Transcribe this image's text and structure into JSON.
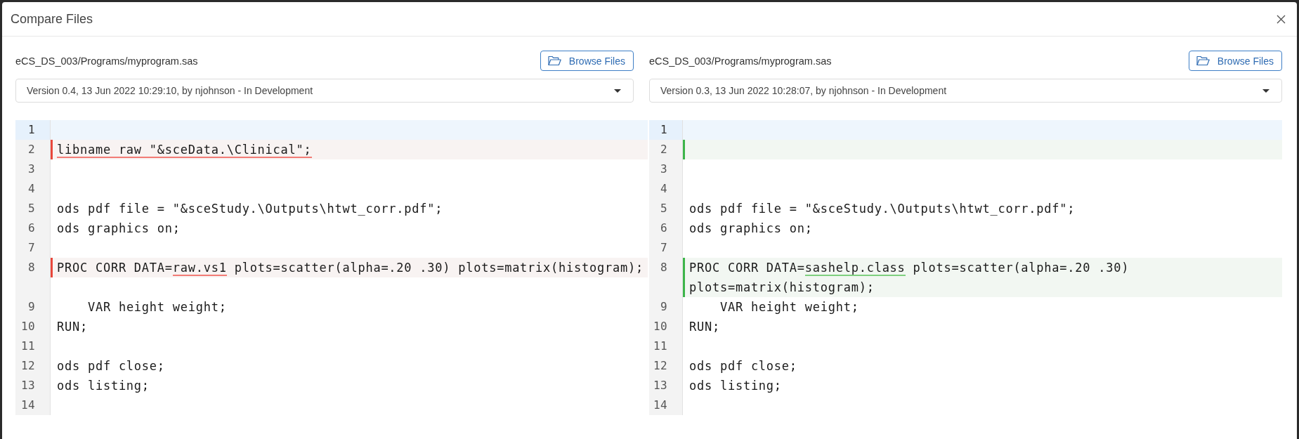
{
  "window": {
    "title": "Compare Files"
  },
  "panes": [
    {
      "path": "eCS_DS_003/Programs/myprogram.sas",
      "browse_button": "Browse Files",
      "version": "Version 0.4, 13 Jun 2022 10:29:10, by njohnson - In Development",
      "lines": [
        {
          "number": "1",
          "active": true,
          "kind": "plain"
        },
        {
          "number": "2",
          "active": false,
          "kind": "removed",
          "segments": [
            {
              "text": "libname raw \"&sceData.\\Clinical\";",
              "changed": true
            }
          ]
        },
        {
          "number": "3",
          "active": false,
          "kind": "plain"
        },
        {
          "number": "4",
          "active": false,
          "kind": "plain"
        },
        {
          "number": "5",
          "active": false,
          "kind": "plain",
          "segments": [
            {
              "text": "ods pdf file = \"&sceStudy.\\Outputs\\htwt_corr.pdf\";",
              "changed": false
            }
          ]
        },
        {
          "number": "6",
          "active": false,
          "kind": "plain",
          "segments": [
            {
              "text": "ods graphics on;",
              "changed": false
            }
          ]
        },
        {
          "number": "7",
          "active": false,
          "kind": "plain"
        },
        {
          "number": "8",
          "active": false,
          "kind": "removed",
          "segments": [
            {
              "text": "PROC CORR DATA=",
              "changed": false
            },
            {
              "text": "raw.vs1",
              "changed": true
            },
            {
              "text": " plots=scatter(alpha=.20 .30) plots=matrix(histogram);",
              "changed": false
            }
          ]
        },
        {
          "number": "9",
          "active": false,
          "kind": "plain",
          "segments": [
            {
              "text": "    VAR height weight;",
              "changed": false
            }
          ]
        },
        {
          "number": "10",
          "active": false,
          "kind": "plain",
          "segments": [
            {
              "text": "RUN;",
              "changed": false
            }
          ]
        },
        {
          "number": "11",
          "active": false,
          "kind": "plain"
        },
        {
          "number": "12",
          "active": false,
          "kind": "plain",
          "segments": [
            {
              "text": "ods pdf close;",
              "changed": false
            }
          ]
        },
        {
          "number": "13",
          "active": false,
          "kind": "plain",
          "segments": [
            {
              "text": "ods listing;",
              "changed": false
            }
          ]
        },
        {
          "number": "14",
          "active": false,
          "kind": "plain"
        }
      ]
    },
    {
      "path": "eCS_DS_003/Programs/myprogram.sas",
      "browse_button": "Browse Files",
      "version": "Version 0.3, 13 Jun 2022 10:28:07, by njohnson - In Development",
      "lines": [
        {
          "number": "1",
          "active": true,
          "kind": "plain"
        },
        {
          "number": "2",
          "active": false,
          "kind": "added"
        },
        {
          "number": "3",
          "active": false,
          "kind": "plain"
        },
        {
          "number": "4",
          "active": false,
          "kind": "plain"
        },
        {
          "number": "5",
          "active": false,
          "kind": "plain",
          "segments": [
            {
              "text": "ods pdf file = \"&sceStudy.\\Outputs\\htwt_corr.pdf\";",
              "changed": false
            }
          ]
        },
        {
          "number": "6",
          "active": false,
          "kind": "plain",
          "segments": [
            {
              "text": "ods graphics on;",
              "changed": false
            }
          ]
        },
        {
          "number": "7",
          "active": false,
          "kind": "plain"
        },
        {
          "number": "8",
          "active": false,
          "kind": "added",
          "segments": [
            {
              "text": "PROC CORR DATA=",
              "changed": false
            },
            {
              "text": "sashelp.class",
              "changed": true
            },
            {
              "text": " plots=scatter(alpha=.20 .30) plots=matrix(histogram);",
              "changed": false
            }
          ]
        },
        {
          "number": "9",
          "active": false,
          "kind": "plain",
          "segments": [
            {
              "text": "    VAR height weight;",
              "changed": false
            }
          ]
        },
        {
          "number": "10",
          "active": false,
          "kind": "plain",
          "segments": [
            {
              "text": "RUN;",
              "changed": false
            }
          ]
        },
        {
          "number": "11",
          "active": false,
          "kind": "plain"
        },
        {
          "number": "12",
          "active": false,
          "kind": "plain",
          "segments": [
            {
              "text": "ods pdf close;",
              "changed": false
            }
          ]
        },
        {
          "number": "13",
          "active": false,
          "kind": "plain",
          "segments": [
            {
              "text": "ods listing;",
              "changed": false
            }
          ]
        },
        {
          "number": "14",
          "active": false,
          "kind": "plain"
        }
      ]
    }
  ]
}
